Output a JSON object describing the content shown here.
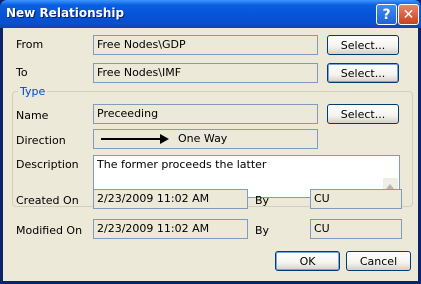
{
  "window": {
    "title": "New Relationship",
    "help_glyph": "?",
    "close_glyph": "✕"
  },
  "from": {
    "label": "From",
    "value": "Free Nodes\\GDP",
    "button": "Select..."
  },
  "to": {
    "label": "To",
    "value": "Free Nodes\\IMF",
    "button": "Select..."
  },
  "type_group": {
    "legend": "Type",
    "name": {
      "label": "Name",
      "value": "Preceeding",
      "button": "Select..."
    },
    "direction": {
      "label": "Direction",
      "value": "One Way"
    },
    "description": {
      "label": "Description",
      "value": "The former proceeds the latter"
    }
  },
  "created": {
    "label": "Created On",
    "value": "2/23/2009 11:02 AM",
    "by_label": "By",
    "by_value": "CU"
  },
  "modified": {
    "label": "Modified On",
    "value": "2/23/2009 11:02 AM",
    "by_label": "By",
    "by_value": "CU"
  },
  "buttons": {
    "ok": "OK",
    "cancel": "Cancel"
  },
  "colors": {
    "title_bar": "#0553d6",
    "dialog_bg": "#ece9d8",
    "group_legend": "#0046d5",
    "field_border": "#7f9db9"
  },
  "icons": {
    "help": "help-icon",
    "close": "close-icon",
    "direction": "arrow-right-icon"
  }
}
